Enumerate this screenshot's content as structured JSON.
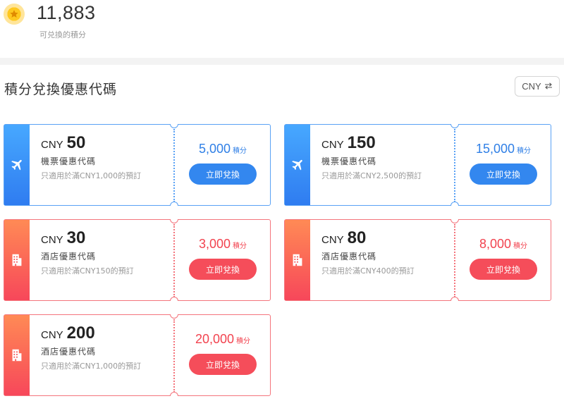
{
  "header": {
    "points_value": "11,883",
    "points_label": "可兑換的積分",
    "coin_icon": "star-coin-icon"
  },
  "section": {
    "title": "積分兌換優惠代碼",
    "currency_label": "CNY",
    "currency_icon": "swap-arrows-icon"
  },
  "colors": {
    "flight_accent": "#2f7fe6",
    "hotel_accent": "#f2434f",
    "coin": "#ffc81f"
  },
  "coupons": [
    {
      "currency": "CNY",
      "amount": "50",
      "title": "機票優惠代碼",
      "condition": "只適用於滿CNY1,000的預訂",
      "points": "5,000",
      "points_unit": "積分",
      "button": "立即兌換",
      "icon": "airplane-icon"
    },
    {
      "currency": "CNY",
      "amount": "150",
      "title": "機票優惠代碼",
      "condition": "只適用於滿CNY2,500的預訂",
      "points": "15,000",
      "points_unit": "積分",
      "button": "立即兌換",
      "icon": "airplane-icon"
    },
    {
      "currency": "CNY",
      "amount": "30",
      "title": "酒店優惠代碼",
      "condition": "只適用於滿CNY150的預訂",
      "points": "3,000",
      "points_unit": "積分",
      "button": "立即兌換",
      "icon": "hotel-building-icon"
    },
    {
      "currency": "CNY",
      "amount": "80",
      "title": "酒店優惠代碼",
      "condition": "只適用於滿CNY400的預訂",
      "points": "8,000",
      "points_unit": "積分",
      "button": "立即兌換",
      "icon": "hotel-building-icon"
    },
    {
      "currency": "CNY",
      "amount": "200",
      "title": "酒店優惠代碼",
      "condition": "只適用於滿CNY1,000的預訂",
      "points": "20,000",
      "points_unit": "積分",
      "button": "立即兌換",
      "icon": "hotel-building-icon"
    }
  ]
}
